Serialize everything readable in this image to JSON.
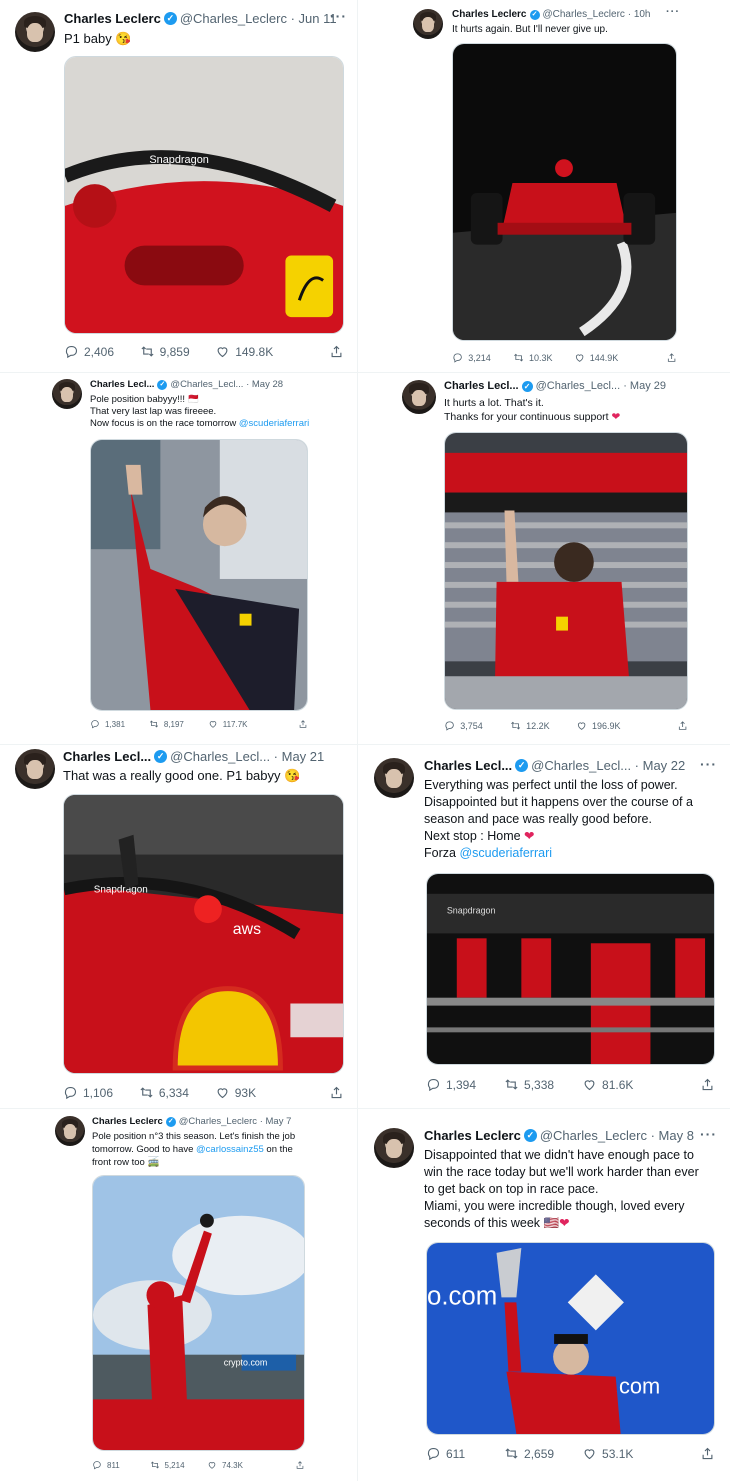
{
  "tweets": [
    {
      "name": "Charles Leclerc",
      "handle": "@Charles_Leclerc",
      "date": "Jun 11",
      "lines": [
        {
          "t": "P1 baby 😘"
        }
      ],
      "replies": "2,406",
      "retweets": "9,859",
      "likes": "149.8K"
    },
    {
      "name": "Charles Leclerc",
      "handle": "@Charles_Leclerc",
      "date": "10h",
      "lines": [
        {
          "t": "It hurts again. But I'll never give up."
        }
      ],
      "replies": "3,214",
      "retweets": "10.3K",
      "likes": "144.9K"
    },
    {
      "name": "Charles Lecl...",
      "handle": "@Charles_Lecl...",
      "date": "May 28",
      "lines": [
        {
          "t": "Pole position babyyy!!! 🇲🇨"
        },
        {
          "t": "That very last lap was fireeee."
        },
        {
          "t": "Now focus is on the race tomorrow ",
          "mention": "@scuderiaferrari"
        }
      ],
      "replies": "1,381",
      "retweets": "8,197",
      "likes": "117.7K"
    },
    {
      "name": "Charles Lecl...",
      "handle": "@Charles_Lecl...",
      "date": "May 29",
      "lines": [
        {
          "t": "It hurts a lot. That's it."
        },
        {
          "t": "Thanks for your continuous support ",
          "heart": "❤"
        }
      ],
      "replies": "3,754",
      "retweets": "12.2K",
      "likes": "196.9K"
    },
    {
      "name": "Charles Lecl...",
      "handle": "@Charles_Lecl...",
      "date": "May 21",
      "lines": [
        {
          "t": "That was a really good one. P1 babyy 😘"
        }
      ],
      "replies": "1,106",
      "retweets": "6,334",
      "likes": "93K"
    },
    {
      "name": "Charles Lecl...",
      "handle": "@Charles_Lecl...",
      "date": "May 22",
      "lines": [
        {
          "t": "Everything was perfect until the loss of power."
        },
        {
          "t": "Disappointed but it happens over the course of a"
        },
        {
          "t": "season and pace was really good before."
        },
        {
          "t": "Next stop : Home ",
          "heart": "❤"
        },
        {
          "t": "Forza ",
          "mention": "@scuderiaferrari"
        }
      ],
      "replies": "1,394",
      "retweets": "5,338",
      "likes": "81.6K"
    },
    {
      "name": "Charles Leclerc",
      "handle": "@Charles_Leclerc",
      "date": "May 7",
      "lines": [
        {
          "t": "Pole position n°3 this season. Let's finish the job"
        },
        {
          "t": "tomorrow. Good to have ",
          "mention": "@carlossainz55",
          "after": " on the"
        },
        {
          "t": "front row too 🚎"
        }
      ],
      "replies": "811",
      "retweets": "5,214",
      "likes": "74.3K"
    },
    {
      "name": "Charles Leclerc",
      "handle": "@Charles_Leclerc",
      "date": "May 8",
      "lines": [
        {
          "t": "Disappointed that we didn't have enough pace to"
        },
        {
          "t": "win the race today but we'll work harder than ever"
        },
        {
          "t": "to get back on top in race pace."
        },
        {
          "t": "Miami, you were incredible though, loved every"
        },
        {
          "t": "seconds of this week 🇺🇸",
          "heart": "❤"
        }
      ],
      "replies": "611",
      "retweets": "2,659",
      "likes": "53.1K"
    }
  ],
  "media_labels": {
    "snapdragon": "Snapdragon",
    "aws": "aws",
    "miami_sponsor": "crypto.com",
    "miami_banner": "o.com"
  },
  "icons": {
    "reply": "reply-icon",
    "retweet": "retweet-icon",
    "like": "heart-icon",
    "share": "share-icon",
    "verified": "verified-badge-icon",
    "more": "more-options-icon"
  },
  "colors": {
    "accent": "#1d9bf0",
    "ferrari_red": "#c8101a",
    "heart": "#e0245e",
    "muted": "#536471"
  }
}
